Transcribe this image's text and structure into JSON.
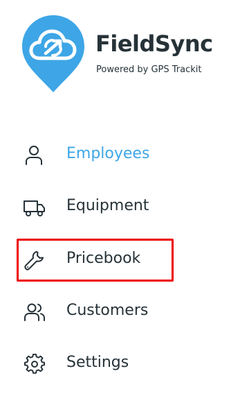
{
  "brand": {
    "name": "FieldSync",
    "tagline": "Powered by GPS Trackit",
    "logo_icon": "cloud-sync-pin-icon",
    "color": "#3ea6e6"
  },
  "menu": {
    "items": [
      {
        "label": "Employees",
        "icon": "user-icon",
        "active": true
      },
      {
        "label": "Equipment",
        "icon": "truck-icon",
        "active": false
      },
      {
        "label": "Pricebook",
        "icon": "wrench-icon",
        "active": false,
        "highlighted": true
      },
      {
        "label": "Customers",
        "icon": "users-icon",
        "active": false
      },
      {
        "label": "Settings",
        "icon": "gear-icon",
        "active": false
      }
    ]
  },
  "colors": {
    "active_text": "#3ea6e6",
    "text": "#263238",
    "highlight_border": "#ee0000"
  }
}
